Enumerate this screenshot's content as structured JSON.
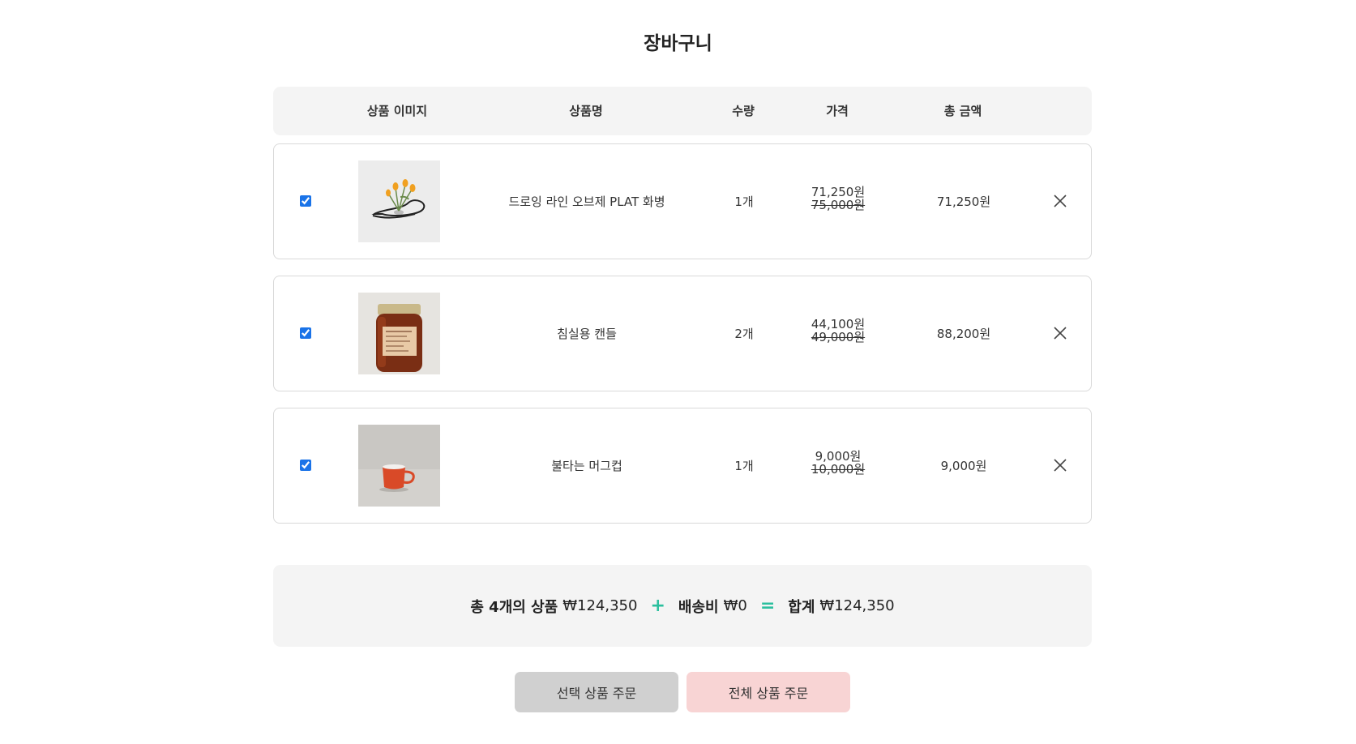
{
  "page": {
    "title": "장바구니"
  },
  "table": {
    "headers": {
      "image": "상품 이미지",
      "name": "상품명",
      "quantity": "수량",
      "price": "가격",
      "total": "총 금액"
    }
  },
  "items": [
    {
      "checked": true,
      "image_icon": "vase-with-flowers",
      "name": "드로잉 라인 오브제 PLAT 화병",
      "quantity": "1개",
      "sale_price": "71,250원",
      "original_price": "75,000원",
      "total": "71,250원"
    },
    {
      "checked": true,
      "image_icon": "amber-candle-jar",
      "name": "침실용 캔들",
      "quantity": "2개",
      "sale_price": "44,100원",
      "original_price": "49,000원",
      "total": "88,200원"
    },
    {
      "checked": true,
      "image_icon": "red-mug",
      "name": "불타는 머그컵",
      "quantity": "1개",
      "sale_price": "9,000원",
      "original_price": "10,000원",
      "total": "9,000원"
    }
  ],
  "summary": {
    "items_label": "총 4개의 상품",
    "items_amount": "₩124,350",
    "plus": "+",
    "shipping_label": "배송비",
    "shipping_amount": "₩0",
    "equals": "=",
    "total_label": "합계",
    "total_amount": "₩124,350"
  },
  "buttons": {
    "order_selected": "선택 상품 주문",
    "order_all": "전체 상품 주문"
  },
  "colors": {
    "accent_operator": "#2bbf9e",
    "order_selected_bg": "#d0d0d0",
    "order_all_bg": "#f8d4d4"
  }
}
